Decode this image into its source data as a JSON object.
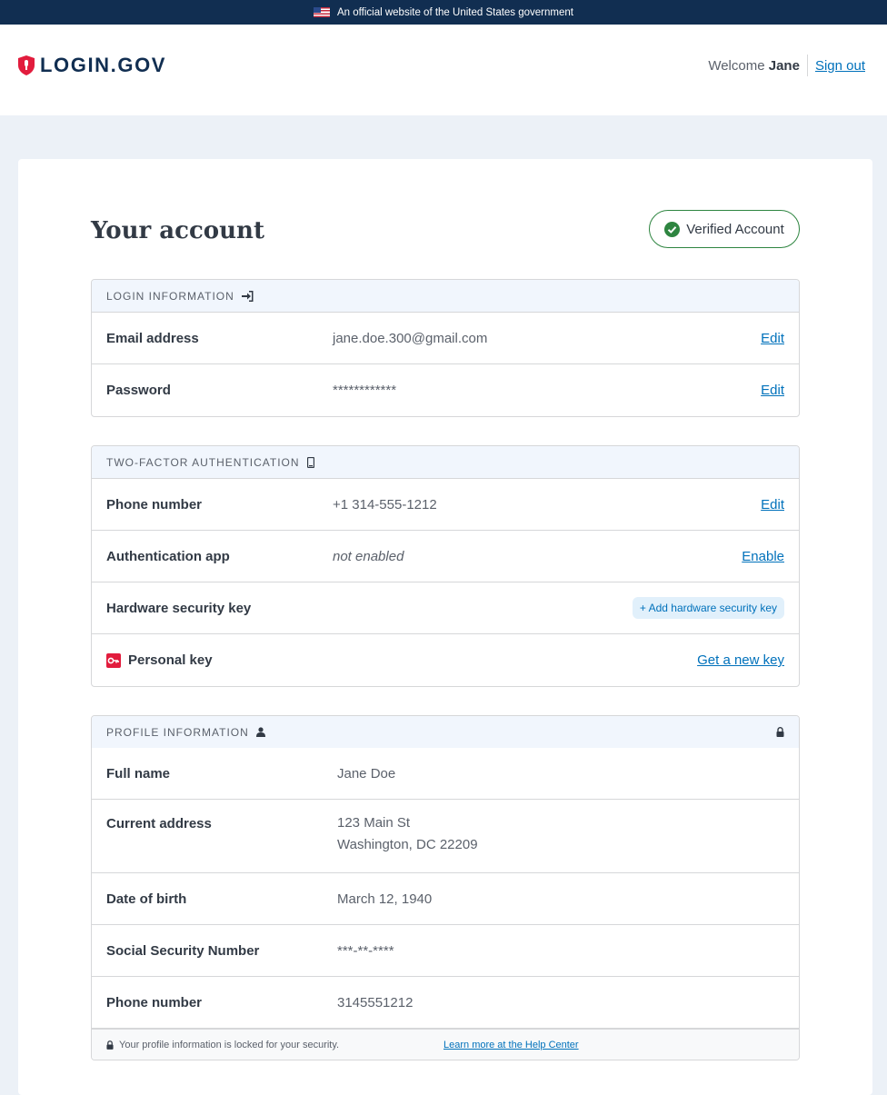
{
  "banner": {
    "text": "An official website of the United States government"
  },
  "header": {
    "logo_text": "LOGIN.GOV",
    "welcome_prefix": "Welcome",
    "user_name": "Jane",
    "sign_out": "Sign out"
  },
  "page": {
    "title": "Your account",
    "verified_label": "Verified Account"
  },
  "login_info": {
    "header": "LOGIN INFORMATION",
    "rows": [
      {
        "label": "Email address",
        "value": "jane.doe.300@gmail.com",
        "action": "Edit"
      },
      {
        "label": "Password",
        "value": "************",
        "action": "Edit"
      }
    ]
  },
  "two_factor": {
    "header": "TWO-FACTOR AUTHENTICATION",
    "rows": [
      {
        "label": "Phone number",
        "value": "+1 314-555-1212",
        "action": "Edit"
      },
      {
        "label": "Authentication app",
        "value": "not enabled",
        "action": "Enable"
      },
      {
        "label": "Hardware security key",
        "value": "",
        "action": "+ Add hardware security key"
      },
      {
        "label": "Personal key",
        "value": "",
        "action": "Get a new key"
      }
    ]
  },
  "profile": {
    "header": "PROFILE INFORMATION",
    "rows": [
      {
        "label": "Full name",
        "value": "Jane Doe"
      },
      {
        "label": "Current address",
        "value": "123 Main St",
        "value2": "Washington, DC 22209"
      },
      {
        "label": "Date of birth",
        "value": "March 12, 1940"
      },
      {
        "label": "Social Security Number",
        "value": "***-**-****"
      },
      {
        "label": "Phone number",
        "value": "3145551212"
      }
    ],
    "footer_text": "Your profile information is locked for your security.",
    "footer_link": "Learn more at the Help Center"
  },
  "colors": {
    "banner_bg": "#112e51",
    "link": "#0071bb",
    "verified_green": "#2e8540",
    "logo_red": "#e21c3d",
    "section_header_bg": "#f1f6fd",
    "page_bg": "#ecf1f7"
  }
}
